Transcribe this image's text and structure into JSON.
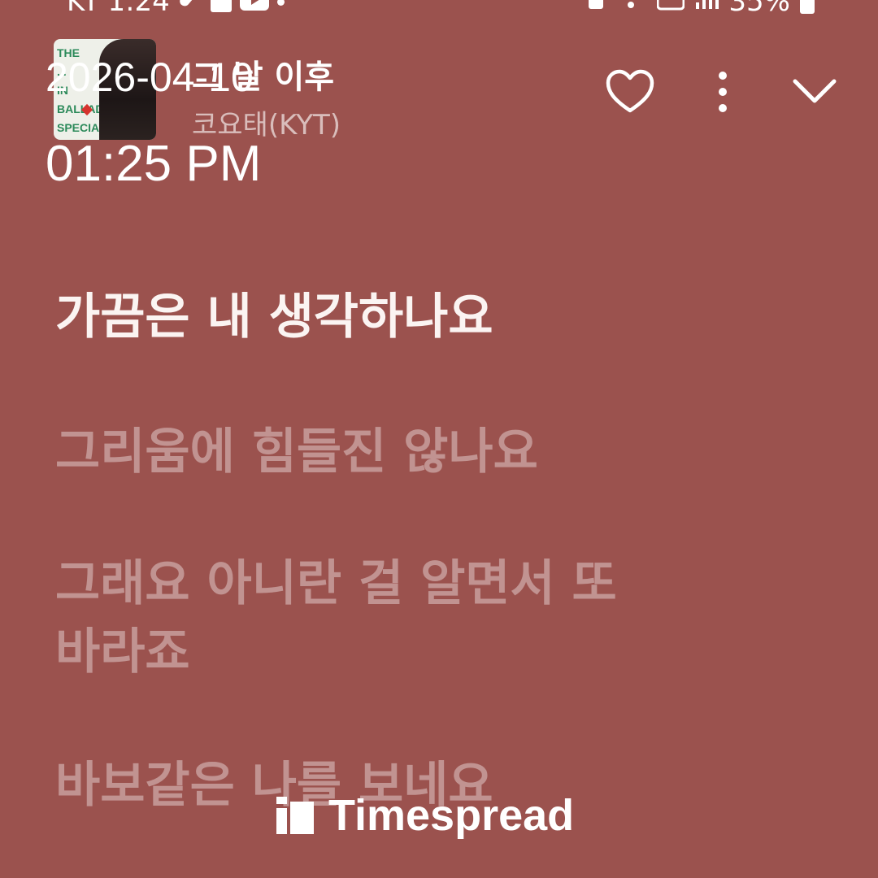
{
  "status_bar": {
    "carrier": "KT",
    "time": "1:24",
    "battery": "35%",
    "left_icons": [
      "pill-icon",
      "gallery-icon",
      "youtube-icon",
      "dot-icon"
    ],
    "right_icons": [
      "music-note-icon",
      "wifi-icon",
      "hd-icon",
      "signal-icon",
      "battery-icon"
    ]
  },
  "now_playing": {
    "album_art_text": [
      "THE",
      "...",
      "IN",
      "BALLAD",
      "SPECIAL"
    ],
    "title": "그 날 이후",
    "artist": "코요태(KYT)"
  },
  "controls": {
    "like_icon": "heart-outline-icon",
    "more_icon": "more-vertical-icon",
    "collapse_icon": "chevron-down-icon"
  },
  "overlay": {
    "date": "2026-04-10",
    "time": "01:25 PM"
  },
  "lyrics": {
    "current": "가끔은 내 생각하나요",
    "lines": [
      "그리움에 힘들진 않나요",
      "그래요 아니란 걸 알면서 또 바라죠",
      "바보같은 나를 보네요"
    ]
  },
  "colors": {
    "background": "#9b524e",
    "current_lyric": "#fbf4f2",
    "dim_lyric": "rgba(255,255,255,0.38)"
  },
  "watermark": {
    "text": "Timespread",
    "icon": "timespread-logo-icon"
  }
}
